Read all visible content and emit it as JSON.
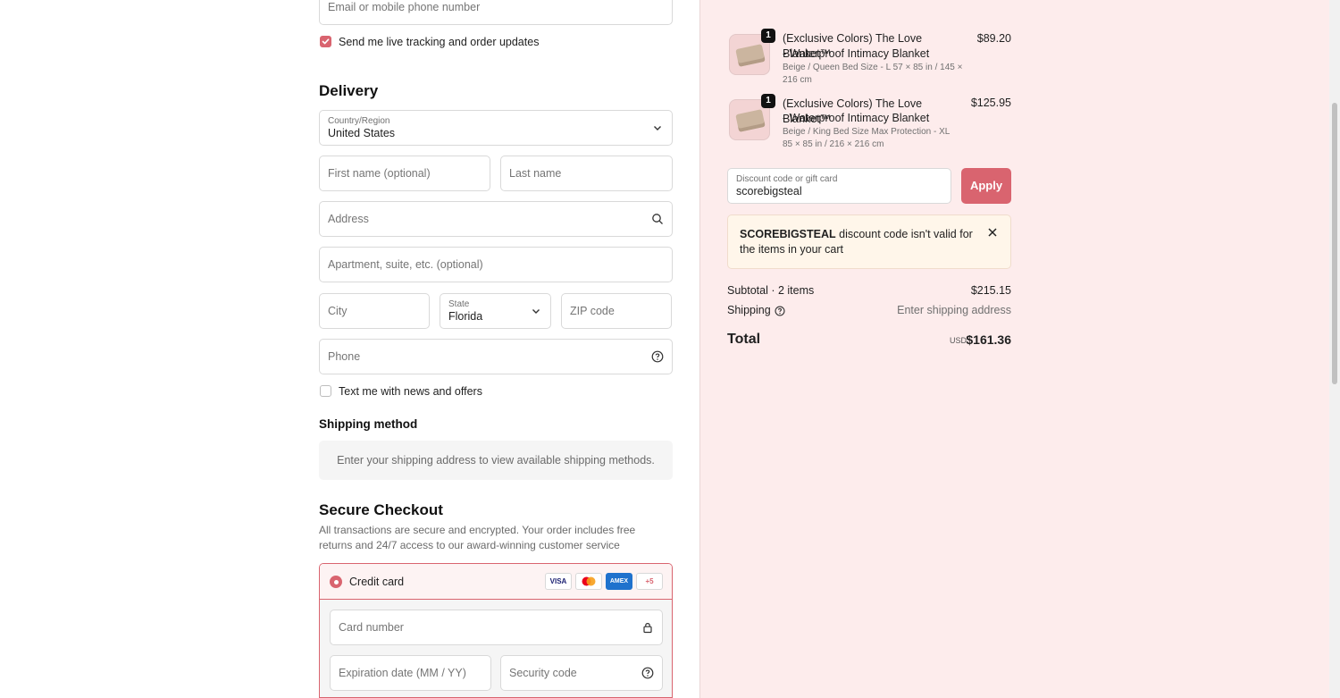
{
  "contact": {
    "email_placeholder": "Email or mobile phone number",
    "tracking_label": "Send me live tracking and order updates",
    "tracking_checked": true
  },
  "delivery": {
    "title": "Delivery",
    "country_label": "Country/Region",
    "country_value": "United States",
    "first_name_placeholder": "First name (optional)",
    "last_name_placeholder": "Last name",
    "address_placeholder": "Address",
    "apartment_placeholder": "Apartment, suite, etc. (optional)",
    "city_placeholder": "City",
    "state_label": "State",
    "state_value": "Florida",
    "zip_placeholder": "ZIP code",
    "phone_placeholder": "Phone",
    "news_label": "Text me with news and offers",
    "news_checked": false
  },
  "shipping": {
    "title": "Shipping method",
    "info": "Enter your shipping address to view available shipping methods."
  },
  "checkout": {
    "title": "Secure Checkout",
    "description_line1": "All transactions are secure and encrypted. Your order includes free",
    "description_line2": "returns and 24/7 access to our award-winning customer service",
    "payment_option": "Credit card",
    "cards": [
      "VISA",
      "MC",
      "AMEX",
      "+5"
    ],
    "card_number_placeholder": "Card number",
    "expiration_placeholder": "Expiration date (MM / YY)",
    "security_code_placeholder": "Security code"
  },
  "cart": {
    "items": [
      {
        "quantity": "1",
        "title_line1": "(Exclusive Colors) The Love Blanket™",
        "title_line2": "- Waterproof Intimacy Blanket",
        "variant_line1": "Beige / Queen Bed Size - L 57 × 85 in / 145 ×",
        "variant_line2": "216 cm",
        "price": "$89.20"
      },
      {
        "quantity": "1",
        "title_line1": "(Exclusive Colors) The Love Blanket™",
        "title_line2": "- Waterproof Intimacy Blanket",
        "variant_line1": "Beige / King Bed Size Max Protection - XL",
        "variant_line2": "85 × 85 in / 216 × 216 cm",
        "price": "$125.95"
      }
    ],
    "discount_label": "Discount code or gift card",
    "discount_value": "scorebigsteal",
    "apply_label": "Apply",
    "error_code": "SCOREBIGSTEAL",
    "error_text": " discount code isn't valid for the items in your cart",
    "subtotal_label": "Subtotal · 2 items",
    "subtotal_value": "$215.15",
    "shipping_label": "Shipping",
    "shipping_value": "Enter shipping address",
    "total_label": "Total",
    "currency": "USD",
    "total_value": "$161.36"
  },
  "colors": {
    "accent": "#d9646f",
    "summary_bg": "#fdecec",
    "notice_bg": "#fff6ea"
  }
}
